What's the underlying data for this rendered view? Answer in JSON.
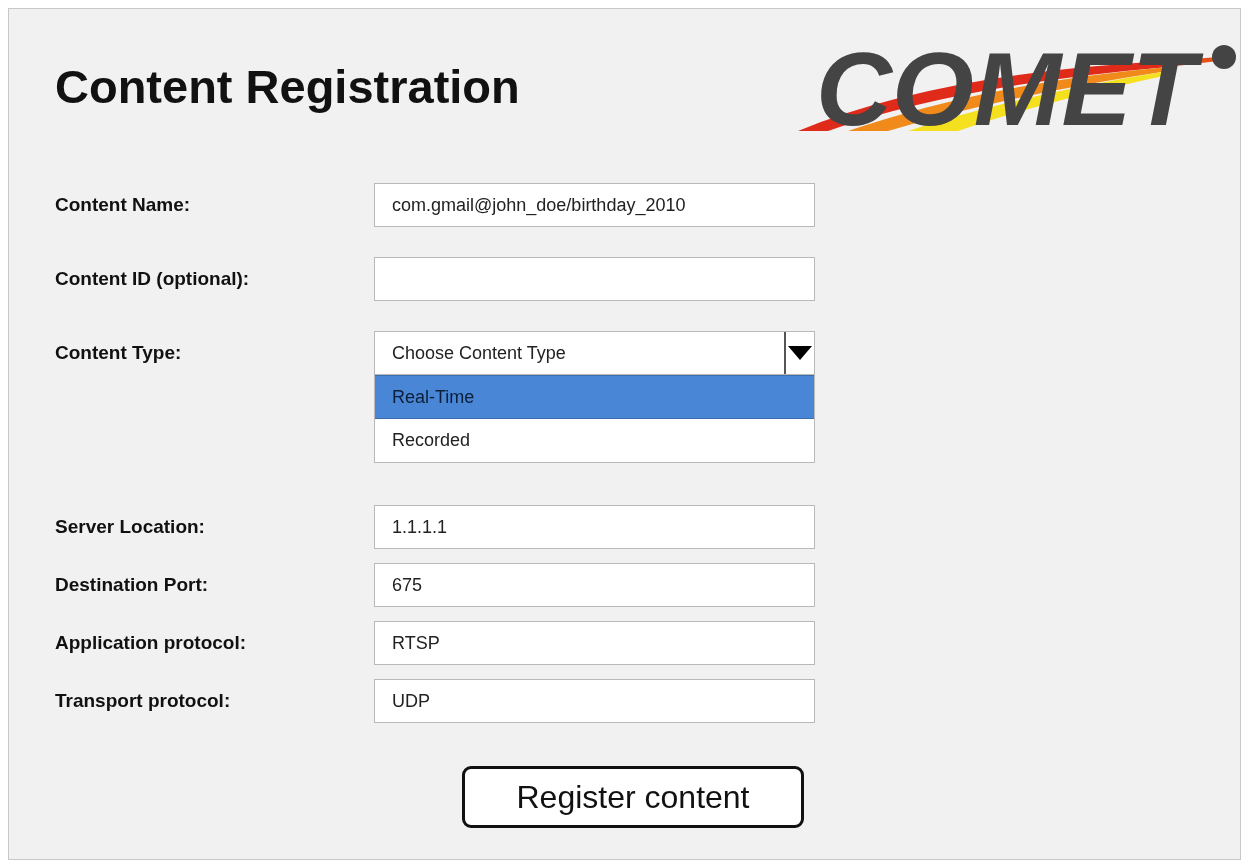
{
  "title": "Content Registration",
  "logo": {
    "text": "COMET"
  },
  "fields": [
    {
      "kind": "text",
      "label": "Content Name:",
      "value": "com.gmail@john_doe/birthday_2010"
    },
    {
      "kind": "text",
      "label": "Content ID (optional):"
    },
    {
      "kind": "select",
      "label": "Content Type:",
      "value": "Choose Content Type",
      "expanded": true,
      "options": [
        {
          "label": "Real-Time",
          "selected": true
        },
        {
          "label": "Recorded",
          "selected": false
        }
      ]
    }
  ],
  "connection_fields": [
    {
      "kind": "text",
      "label": "Server Location:",
      "value": "1.1.1.1"
    },
    {
      "kind": "text",
      "label": "Destination Port:",
      "value": "675"
    },
    {
      "kind": "text",
      "label": "Application protocol:",
      "value": "RTSP"
    },
    {
      "kind": "text",
      "label": "Transport protocol:",
      "value": "UDP"
    }
  ],
  "button": {
    "label": "Register content"
  }
}
